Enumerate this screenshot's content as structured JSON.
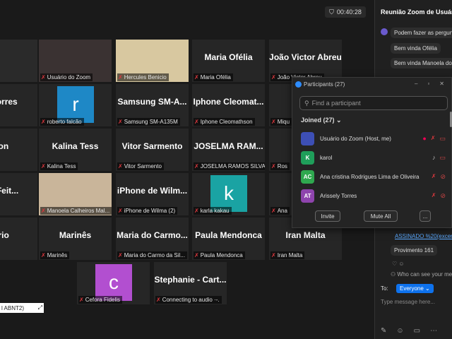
{
  "timer": "00:40:28",
  "tiles": [
    {
      "name": "",
      "label": "",
      "photo": "#2a2a2a"
    },
    {
      "name": "",
      "label": "Usuário do Zoom",
      "photo": "#3a3232"
    },
    {
      "name": "",
      "label": "Hercules Benicio",
      "photo": "#d8c8a0"
    },
    {
      "name": "Maria Ofélia",
      "label": "Maria Ofélia"
    },
    {
      "name": "João Victor Abreu",
      "label": "João Victor Abreu"
    },
    {
      "name": "e Torres",
      "label": "rres"
    },
    {
      "name": "",
      "label": "roberto falcão",
      "avatar": "r",
      "avcolor": "#1e88c6"
    },
    {
      "name": "Samsung SM-A...",
      "label": "Samsung SM-A135M"
    },
    {
      "name": "Iphone Cleomat...",
      "label": "Iphone Cleomathson"
    },
    {
      "name": "Miq",
      "label": "Miqu"
    },
    {
      "name": "son",
      "label": ""
    },
    {
      "name": "Kalina Tess",
      "label": "Kalina Tess"
    },
    {
      "name": "Vitor Sarmento",
      "label": "Vitor Sarmento"
    },
    {
      "name": "JOSELMA RAM...",
      "label": "JOSELMA RAMOS SILVA"
    },
    {
      "name": "Rosa",
      "label": "Ros"
    },
    {
      "name": "on Feit...",
      "label": "Feitosa"
    },
    {
      "name": "",
      "label": "Manoela Calheiros Mal...",
      "photo": "#c9b59a"
    },
    {
      "name": "iPhone de Wilm...",
      "label": "iPhone de Wilma (2)"
    },
    {
      "name": "",
      "label": "karla kakau",
      "avatar": "k",
      "avcolor": "#1aa3a3"
    },
    {
      "name": "Ana c",
      "label": "Ana"
    },
    {
      "name": "ório",
      "label": ""
    },
    {
      "name": "Marinês",
      "label": "Marinês"
    },
    {
      "name": "Maria do Carmo...",
      "label": "Maria do Carmo da Sil..."
    },
    {
      "name": "Paula Mendonca",
      "label": "Paula Mendonca"
    },
    {
      "name": "Iran Malta",
      "label": "Iran Malta"
    },
    {
      "name": "",
      "label": "Cefora Fidelis",
      "avatar": "c",
      "avcolor": "#b24fd0"
    },
    {
      "name": "Stephanie - Cart...",
      "label": "Connecting to audio ·-."
    }
  ],
  "keyboard_hint": "l ABNT2)",
  "chat": {
    "title": "Reunião Zoom de Usuário",
    "to_label": "To:",
    "to_value": "Everyone",
    "messages": [
      "Podem fazer as pergunt",
      "Bem vinda Ofélia",
      "Bem vinda Manoela do",
      "Provimento 161"
    ],
    "link": "ASSINADO %20(excerto",
    "who_can_see": "Who can see your me",
    "placeholder": "Type message here..."
  },
  "participants": {
    "title": "Participants (27)",
    "search_placeholder": "Find a participant",
    "joined": "Joined (27)",
    "rows": [
      {
        "initials": "",
        "name": "Usuário do Zoom (Host, me)",
        "color": "#3d4fb5"
      },
      {
        "initials": "K",
        "name": "karol",
        "color": "#1f9e5a"
      },
      {
        "initials": "AC",
        "name": "Ana cristina Rodrigues Lima de Oliveira",
        "color": "#2fa84f"
      },
      {
        "initials": "AT",
        "name": "Arissely Torres",
        "color": "#8e44ad"
      }
    ],
    "invite": "Invite",
    "mute_all": "Mute All",
    "more": "..."
  }
}
